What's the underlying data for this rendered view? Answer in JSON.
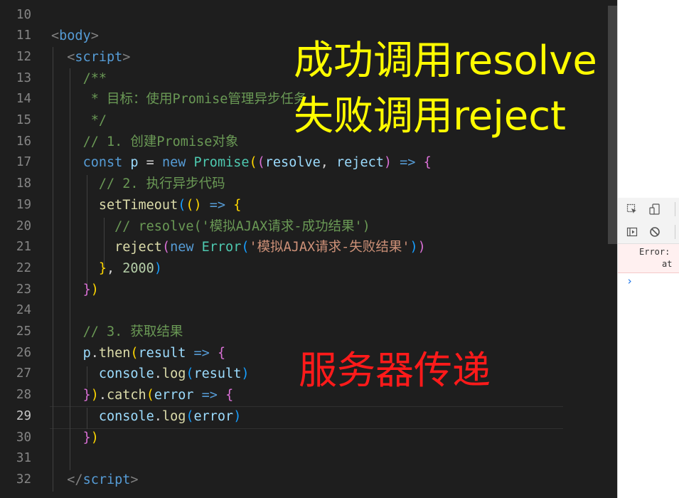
{
  "editor": {
    "active_line": "29",
    "lines": [
      {
        "no": "10"
      },
      {
        "no": "11",
        "t": [
          [
            "t-br",
            "<"
          ],
          [
            "t-tag",
            "body"
          ],
          [
            "t-br",
            ">"
          ]
        ]
      },
      {
        "no": "12",
        "t": [
          [
            "t-p",
            "  "
          ],
          [
            "t-br",
            "<"
          ],
          [
            "t-tag",
            "script"
          ],
          [
            "t-br",
            ">"
          ]
        ]
      },
      {
        "no": "13",
        "t": [
          [
            "t-p",
            "    "
          ],
          [
            "t-com",
            "/**"
          ]
        ]
      },
      {
        "no": "14",
        "t": [
          [
            "t-p",
            "    "
          ],
          [
            "t-com",
            " * 目标：使用Promise管理异步任务"
          ]
        ]
      },
      {
        "no": "15",
        "t": [
          [
            "t-p",
            "    "
          ],
          [
            "t-com",
            " */"
          ]
        ]
      },
      {
        "no": "16",
        "t": [
          [
            "t-p",
            "    "
          ],
          [
            "t-com",
            "// 1. 创建Promise对象"
          ]
        ]
      },
      {
        "no": "17",
        "t": [
          [
            "t-p",
            "    "
          ],
          [
            "t-kw",
            "const"
          ],
          [
            "t-p",
            " "
          ],
          [
            "t-var",
            "p"
          ],
          [
            "t-p",
            " = "
          ],
          [
            "t-kw",
            "new"
          ],
          [
            "t-p",
            " "
          ],
          [
            "t-cls",
            "Promise"
          ],
          [
            "b1",
            "("
          ],
          [
            "b2",
            "("
          ],
          [
            "t-var",
            "resolve"
          ],
          [
            "t-p",
            ", "
          ],
          [
            "t-var",
            "reject"
          ],
          [
            "b2",
            ")"
          ],
          [
            "t-p",
            " "
          ],
          [
            "t-kw",
            "=>"
          ],
          [
            "t-p",
            " "
          ],
          [
            "b2",
            "{"
          ]
        ]
      },
      {
        "no": "18",
        "t": [
          [
            "t-p",
            "      "
          ],
          [
            "t-com",
            "// 2. 执行异步代码"
          ]
        ]
      },
      {
        "no": "19",
        "t": [
          [
            "t-p",
            "      "
          ],
          [
            "t-fn",
            "setTimeout"
          ],
          [
            "b3",
            "("
          ],
          [
            "b1",
            "("
          ],
          [
            "b1",
            ")"
          ],
          [
            "t-p",
            " "
          ],
          [
            "t-kw",
            "=>"
          ],
          [
            "t-p",
            " "
          ],
          [
            "b1",
            "{"
          ]
        ]
      },
      {
        "no": "20",
        "t": [
          [
            "t-p",
            "        "
          ],
          [
            "t-com",
            "// resolve('模拟AJAX请求-成功结果')"
          ]
        ]
      },
      {
        "no": "21",
        "t": [
          [
            "t-p",
            "        "
          ],
          [
            "t-fn",
            "reject"
          ],
          [
            "b2",
            "("
          ],
          [
            "t-kw",
            "new"
          ],
          [
            "t-p",
            " "
          ],
          [
            "t-cls",
            "Error"
          ],
          [
            "b3",
            "("
          ],
          [
            "t-str",
            "'模拟AJAX请求-失败结果'"
          ],
          [
            "b3",
            ")"
          ],
          [
            "b2",
            ")"
          ]
        ]
      },
      {
        "no": "22",
        "t": [
          [
            "t-p",
            "      "
          ],
          [
            "b1",
            "}"
          ],
          [
            "t-p",
            ", "
          ],
          [
            "t-num",
            "2000"
          ],
          [
            "b3",
            ")"
          ]
        ]
      },
      {
        "no": "23",
        "t": [
          [
            "t-p",
            "    "
          ],
          [
            "b2",
            "}"
          ],
          [
            "b1",
            ")"
          ]
        ]
      },
      {
        "no": "24"
      },
      {
        "no": "25",
        "t": [
          [
            "t-p",
            "    "
          ],
          [
            "t-com",
            "// 3. 获取结果"
          ]
        ]
      },
      {
        "no": "26",
        "t": [
          [
            "t-p",
            "    "
          ],
          [
            "t-var",
            "p"
          ],
          [
            "t-p",
            "."
          ],
          [
            "t-fn",
            "then"
          ],
          [
            "b1",
            "("
          ],
          [
            "t-var",
            "result"
          ],
          [
            "t-p",
            " "
          ],
          [
            "t-kw",
            "=>"
          ],
          [
            "t-p",
            " "
          ],
          [
            "b2",
            "{"
          ]
        ]
      },
      {
        "no": "27",
        "t": [
          [
            "t-p",
            "      "
          ],
          [
            "t-var",
            "console"
          ],
          [
            "t-p",
            "."
          ],
          [
            "t-fn",
            "log"
          ],
          [
            "b3",
            "("
          ],
          [
            "t-var",
            "result"
          ],
          [
            "b3",
            ")"
          ]
        ]
      },
      {
        "no": "28",
        "t": [
          [
            "t-p",
            "    "
          ],
          [
            "b2",
            "}"
          ],
          [
            "b1",
            ")"
          ],
          [
            "t-p",
            "."
          ],
          [
            "t-fn",
            "catch"
          ],
          [
            "b1",
            "("
          ],
          [
            "t-var",
            "error"
          ],
          [
            "t-p",
            " "
          ],
          [
            "t-kw",
            "=>"
          ],
          [
            "t-p",
            " "
          ],
          [
            "b2",
            "{"
          ]
        ]
      },
      {
        "no": "29",
        "t": [
          [
            "t-p",
            "      "
          ],
          [
            "t-var",
            "console"
          ],
          [
            "t-p",
            "."
          ],
          [
            "t-fn",
            "log"
          ],
          [
            "b3",
            "("
          ],
          [
            "t-var",
            "error"
          ],
          [
            "b3",
            ")"
          ]
        ]
      },
      {
        "no": "30",
        "t": [
          [
            "t-p",
            "    "
          ],
          [
            "b2",
            "}"
          ],
          [
            "b1",
            ")"
          ]
        ]
      },
      {
        "no": "31"
      },
      {
        "no": "32",
        "t": [
          [
            "t-p",
            "  "
          ],
          [
            "t-br",
            "</"
          ],
          [
            "t-tag",
            "script"
          ],
          [
            "t-br",
            ">"
          ]
        ]
      }
    ]
  },
  "overlay": {
    "line1": "成功调用resolve",
    "line2": "失败调用reject",
    "line3": "服务器传递"
  },
  "devtools": {
    "error_line1": "Error:",
    "error_line2": "at",
    "prompt": "›",
    "icons": [
      "inspect-icon",
      "device-toggle-icon",
      "sidebar-toggle-icon",
      "clear-console-icon"
    ]
  },
  "colors": {
    "editor_bg": "#1e1e1e",
    "overlay_yellow": "#fffc00",
    "overlay_red": "#ff1a1a"
  }
}
